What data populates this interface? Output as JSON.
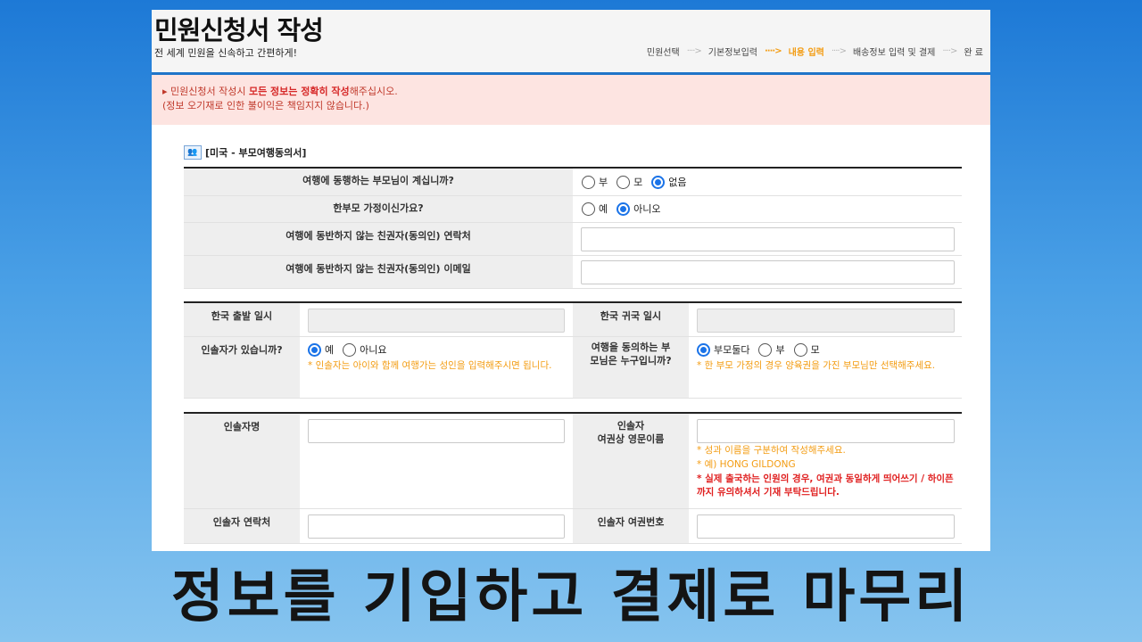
{
  "header": {
    "title": "민원신청서 작성",
    "subtitle": "전 세계 민원을 신속하고 간편하게!",
    "steps": [
      "민원선택",
      "기본정보입력",
      "내용 입력",
      "배송정보 입력 및 결제",
      "완 료"
    ],
    "active_step": "내용 입력",
    "accent_color": "#f39c12",
    "border_color": "#1f74c8"
  },
  "notice": {
    "line1_prefix": "▸ 민원신청서 작성시 ",
    "line1_bold": "모든 정보는 정확히 작성",
    "line1_suffix": "해주십시오.",
    "line2": "(정보 오기재로 인한 불이익은 책임지지 않습니다.)"
  },
  "section": {
    "icon": "people-icon",
    "title": "[미국 - 부모여행동의서]"
  },
  "form1": {
    "q1": {
      "label": "여행에 동행하는 부모님이 계십니까?",
      "options": [
        "부",
        "모",
        "없음"
      ],
      "selected": "없음"
    },
    "q2": {
      "label": "한부모 가정이신가요?",
      "options": [
        "예",
        "아니오"
      ],
      "selected": "아니오"
    },
    "q3": {
      "label": "여행에 동반하지 않는 친권자(동의인) 연락처",
      "value": ""
    },
    "q4": {
      "label": "여행에 동반하지 않는 친권자(동의인) 이메일",
      "value": ""
    }
  },
  "form2": {
    "departure": {
      "label": "한국 출발 일시",
      "value": ""
    },
    "return": {
      "label": "한국 귀국 일시",
      "value": ""
    },
    "guardian": {
      "label": "인솔자가 있습니까?",
      "options": [
        "예",
        "아니요"
      ],
      "selected": "예",
      "hint": "* 인솔자는 아이와 함께 여행가는 성인을 입력해주시면 됩니다."
    },
    "consent": {
      "label": "여행을 동의하는 부모님은 누구입니까?",
      "options": [
        "부모둘다",
        "부",
        "모"
      ],
      "selected": "부모둘다",
      "hint": "* 한 부모 가정의 경우 양육권을 가진 부모님만 선택해주세요."
    }
  },
  "form3": {
    "name": {
      "label": "인솔자명",
      "value": ""
    },
    "eng_name": {
      "label_line1": "인솔자",
      "label_line2": "여권상 영문이름",
      "value": "",
      "hint1": "* 성과 이름을 구분하여 작성해주세요.",
      "hint2": "* 예) HONG GILDONG",
      "hint3": "* 실제 출국하는 인원의 경우, 여권과 동일하게 띄어쓰기 / 하이픈까지 유의하셔서 기재 부탁드립니다."
    },
    "contact": {
      "label": "인솔자 연락처",
      "value": ""
    },
    "passport": {
      "label": "인솔자 여권번호",
      "value": ""
    }
  },
  "caption": "정보를 기입하고 결제로 마무리"
}
